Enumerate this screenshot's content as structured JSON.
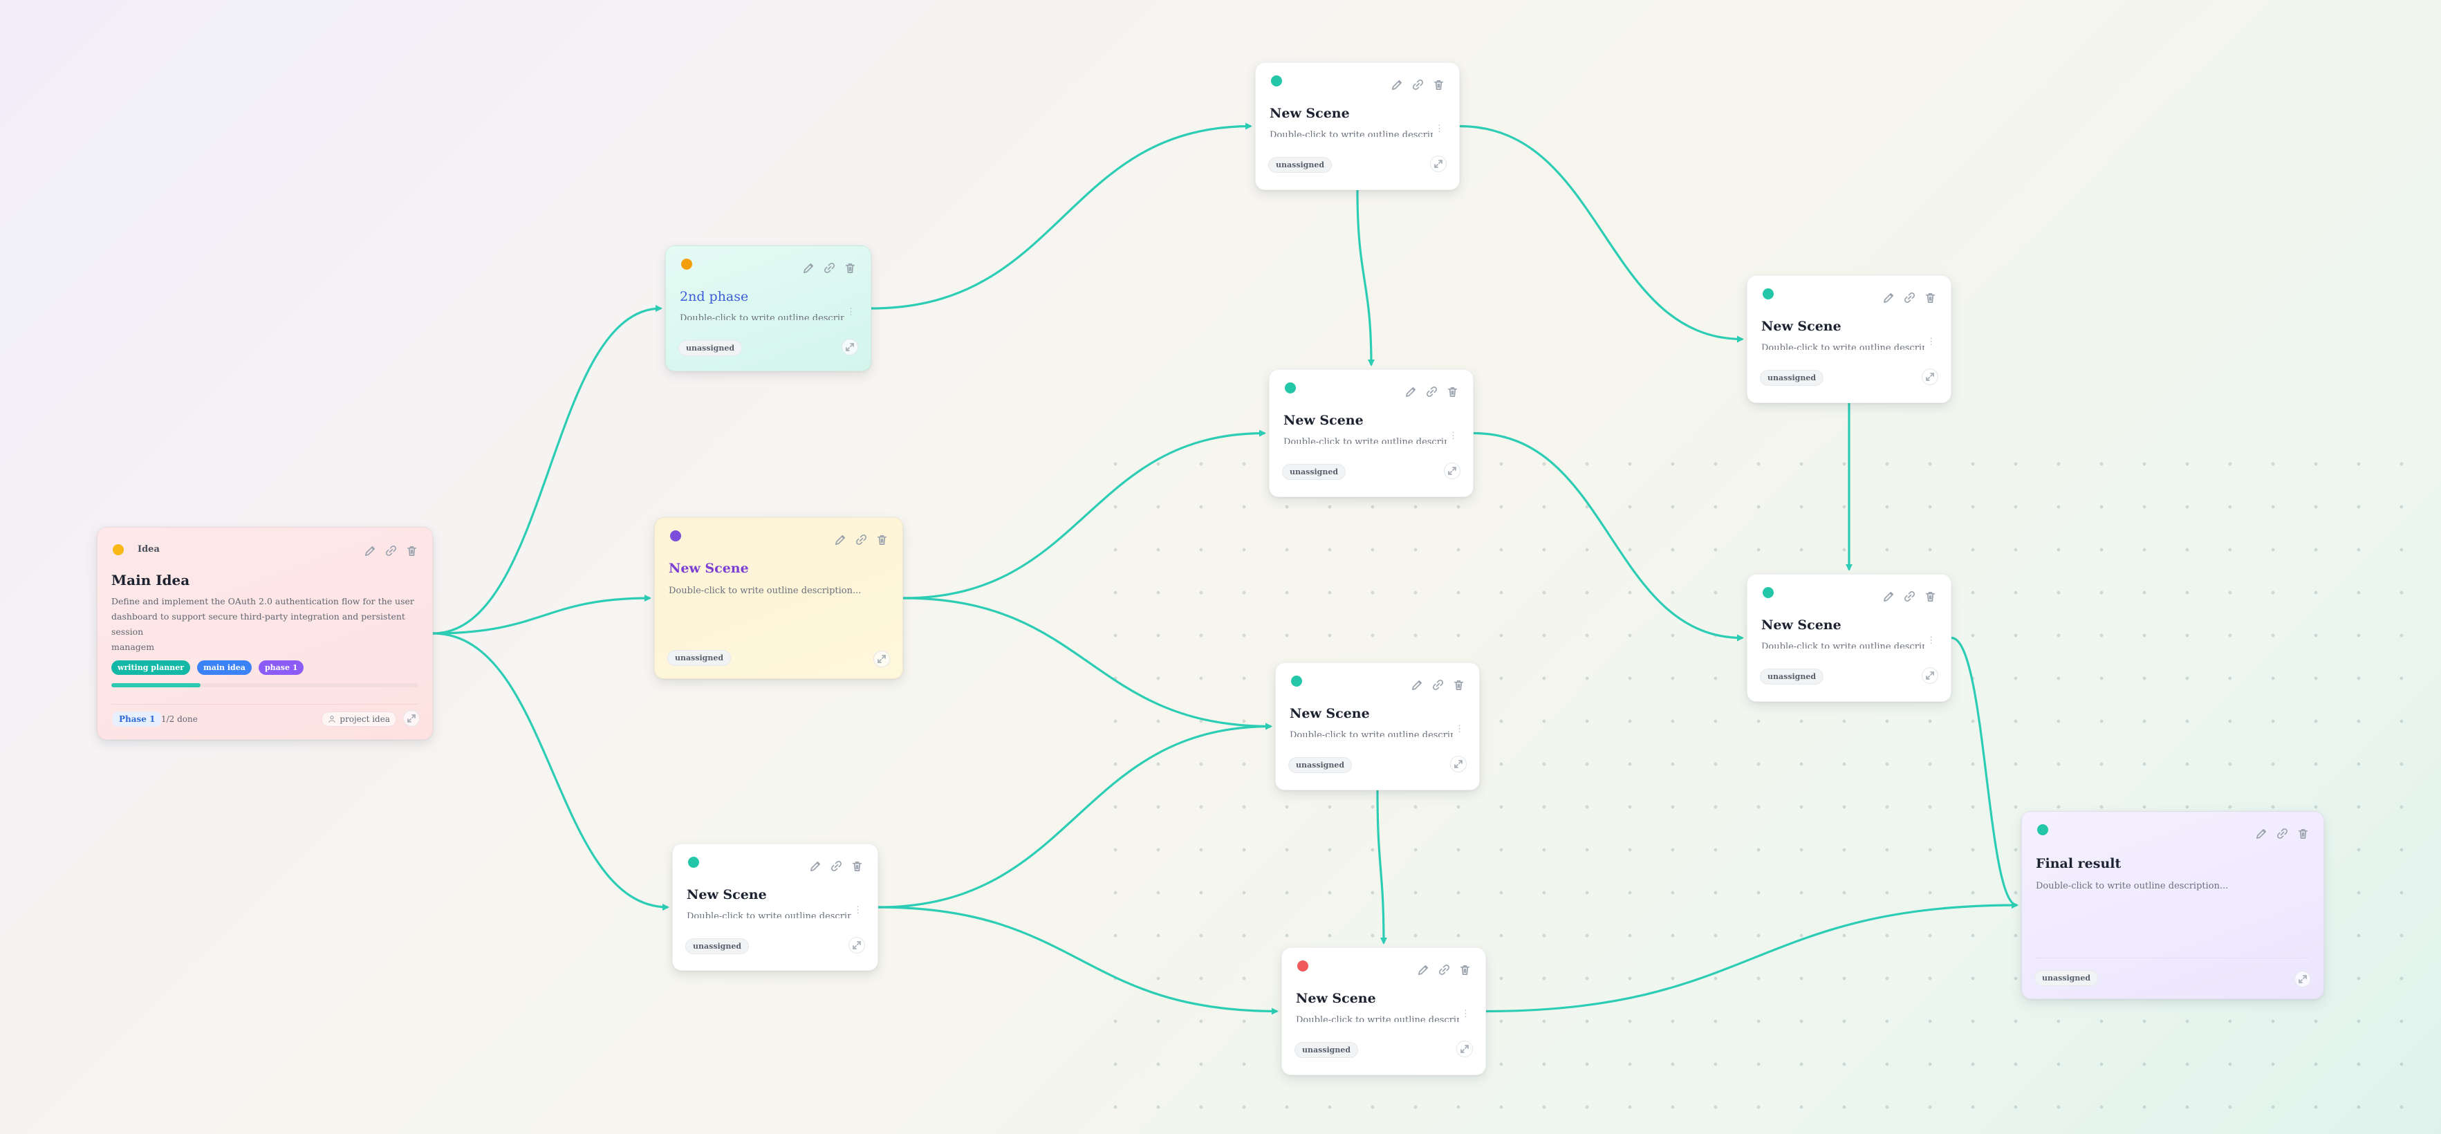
{
  "colors": {
    "edge": "#2ccdb4",
    "status_teal": "#23c7a8",
    "status_orange": "#f59e0b",
    "status_purple": "#7c4ddb",
    "status_red": "#f05a5a",
    "status_yellow": "#f8b817",
    "tag_writing_planner": "#14b8a6",
    "tag_main_idea": "#3b82f6",
    "tag_phase_1": "#8b5cf6"
  },
  "toolbar_icons": [
    "pencil-icon",
    "link-icon",
    "trash-icon"
  ],
  "main_idea": {
    "type_label": "Idea",
    "title": "Main Idea",
    "description_lines": [
      "Define and implement the OAuth 2.0 authentication flow for the user",
      "dashboard to support secure third-party integration and persistent session",
      "managem"
    ],
    "tags": [
      "writing planner",
      "main idea",
      "phase 1"
    ],
    "progress": 0.29,
    "phase_badge": "Phase 1",
    "done_count": "1/2 done",
    "owner": "project idea"
  },
  "nodes": [
    {
      "id": "n2",
      "title": "2nd phase",
      "description": "Double-click to write outline description...",
      "assignee": "unassigned",
      "status_color": "orange"
    },
    {
      "id": "n3",
      "title": "New Scene",
      "description": "Double-click to write outline description...",
      "assignee": "unassigned",
      "status_color": "purple"
    },
    {
      "id": "n4",
      "title": "New Scene",
      "description": "Double-click to write outline description...",
      "assignee": "unassigned",
      "status_color": "teal"
    },
    {
      "id": "n5",
      "title": "New Scene",
      "description": "Double-click to write outline description...",
      "assignee": "unassigned",
      "status_color": "teal"
    },
    {
      "id": "n6",
      "title": "New Scene",
      "description": "Double-click to write outline description...",
      "assignee": "unassigned",
      "status_color": "teal"
    },
    {
      "id": "n7",
      "title": "New Scene",
      "description": "Double-click to write outline description...",
      "assignee": "unassigned",
      "status_color": "teal"
    },
    {
      "id": "n8",
      "title": "New Scene",
      "description": "Double-click to write outline description...",
      "assignee": "unassigned",
      "status_color": "red"
    },
    {
      "id": "n9",
      "title": "New Scene",
      "description": "Double-click to write outline description...",
      "assignee": "unassigned",
      "status_color": "teal"
    },
    {
      "id": "n10",
      "title": "New Scene",
      "description": "Double-click to write outline description...",
      "assignee": "unassigned",
      "status_color": "teal"
    },
    {
      "id": "n11",
      "title": "Final result",
      "description": "Double-click to write outline description...",
      "assignee": "unassigned",
      "status_color": "teal"
    }
  ],
  "edges": [
    [
      "main",
      "n2"
    ],
    [
      "main",
      "n3"
    ],
    [
      "main",
      "n4"
    ],
    [
      "n2",
      "n5"
    ],
    [
      "n5",
      "n6"
    ],
    [
      "n5",
      "n9"
    ],
    [
      "n3",
      "n6"
    ],
    [
      "n3",
      "n7"
    ],
    [
      "n4",
      "n7"
    ],
    [
      "n4",
      "n8"
    ],
    [
      "n6",
      "n10"
    ],
    [
      "n9",
      "n10"
    ],
    [
      "n7",
      "n8"
    ],
    [
      "n8",
      "n11"
    ],
    [
      "n10",
      "n11"
    ]
  ]
}
